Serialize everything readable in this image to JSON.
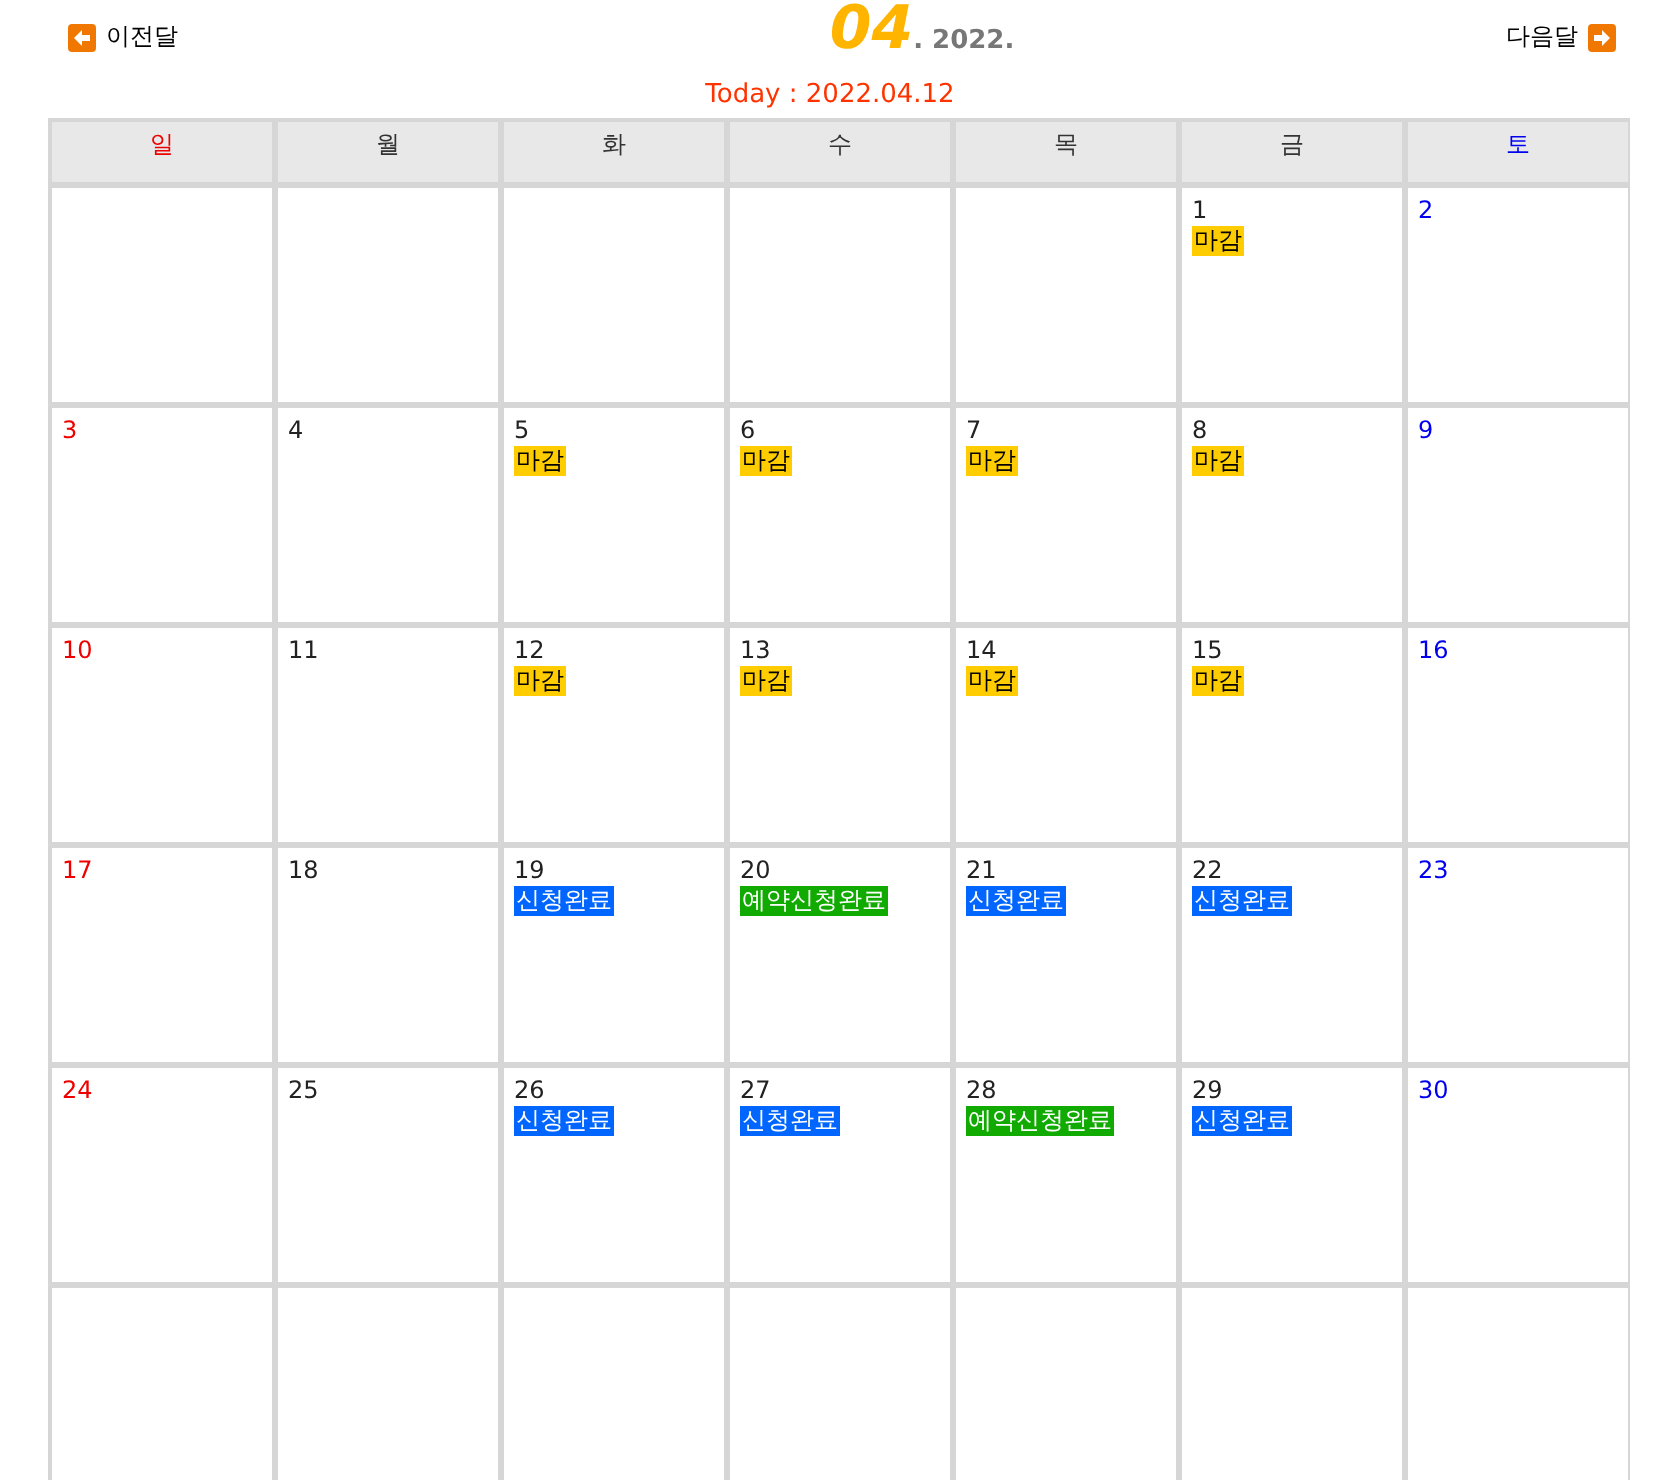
{
  "nav": {
    "prev": "이전달",
    "next": "다음달"
  },
  "title": {
    "month": "04",
    "year": ". 2022."
  },
  "today": "Today : 2022.04.12",
  "weekdays": [
    "일",
    "월",
    "화",
    "수",
    "목",
    "금",
    "토"
  ],
  "weeks": [
    [
      {
        "kind": "empty"
      },
      {
        "kind": "empty"
      },
      {
        "kind": "empty"
      },
      {
        "kind": "empty"
      },
      {
        "kind": "empty"
      },
      {
        "day": "1",
        "events": [
          {
            "label": "마감",
            "color": "#ffcc00"
          }
        ]
      },
      {
        "day": "2"
      }
    ],
    [
      {
        "day": "3"
      },
      {
        "day": "4"
      },
      {
        "day": "5",
        "events": [
          {
            "label": "마감",
            "color": "#ffcc00"
          }
        ]
      },
      {
        "day": "6",
        "events": [
          {
            "label": "마감",
            "color": "#ffcc00"
          }
        ]
      },
      {
        "day": "7",
        "events": [
          {
            "label": "마감",
            "color": "#ffcc00"
          }
        ]
      },
      {
        "day": "8",
        "events": [
          {
            "label": "마감",
            "color": "#ffcc00"
          }
        ]
      },
      {
        "day": "9"
      }
    ],
    [
      {
        "day": "10"
      },
      {
        "day": "11"
      },
      {
        "day": "12",
        "events": [
          {
            "label": "마감",
            "color": "#ffcc00"
          }
        ]
      },
      {
        "day": "13",
        "events": [
          {
            "label": "마감",
            "color": "#ffcc00"
          }
        ]
      },
      {
        "day": "14",
        "events": [
          {
            "label": "마감",
            "color": "#ffcc00"
          }
        ]
      },
      {
        "day": "15",
        "events": [
          {
            "label": "마감",
            "color": "#ffcc00"
          }
        ]
      },
      {
        "day": "16"
      }
    ],
    [
      {
        "day": "17"
      },
      {
        "day": "18"
      },
      {
        "day": "19",
        "events": [
          {
            "label": "신청완료",
            "color": "#0066ff"
          }
        ]
      },
      {
        "day": "20",
        "events": [
          {
            "label": "예약신청완료",
            "color": "#11aa00"
          }
        ]
      },
      {
        "day": "21",
        "events": [
          {
            "label": "신청완료",
            "color": "#0066ff"
          }
        ]
      },
      {
        "day": "22",
        "events": [
          {
            "label": "신청완료",
            "color": "#0066ff"
          }
        ]
      },
      {
        "day": "23"
      }
    ],
    [
      {
        "day": "24"
      },
      {
        "day": "25"
      },
      {
        "day": "26",
        "events": [
          {
            "label": "신청완료",
            "color": "#0066ff"
          }
        ]
      },
      {
        "day": "27",
        "events": [
          {
            "label": "신청완료",
            "color": "#0066ff"
          }
        ]
      },
      {
        "day": "28",
        "events": [
          {
            "label": "예약신청완료",
            "color": "#11aa00"
          }
        ]
      },
      {
        "day": "29",
        "events": [
          {
            "label": "신청완료",
            "color": "#0066ff"
          }
        ]
      },
      {
        "day": "30"
      }
    ],
    [
      {
        "kind": "empty"
      },
      {
        "kind": "empty"
      },
      {
        "kind": "empty"
      },
      {
        "kind": "empty"
      },
      {
        "kind": "empty"
      },
      {
        "kind": "empty"
      },
      {
        "kind": "empty"
      }
    ]
  ]
}
